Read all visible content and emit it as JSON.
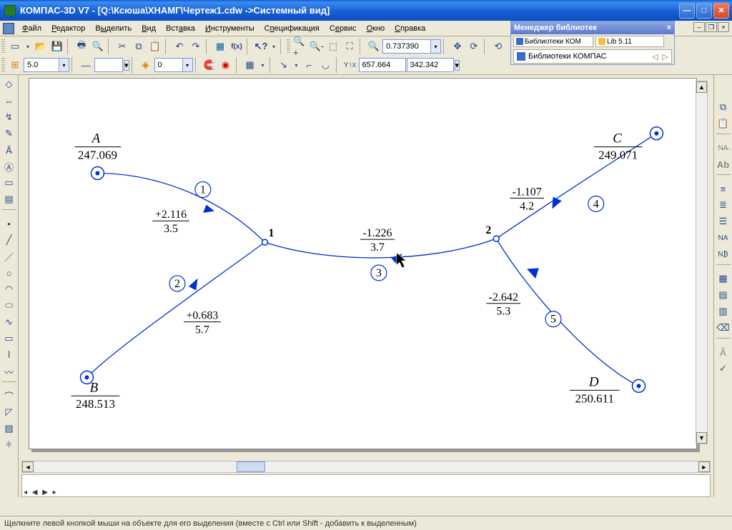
{
  "title": "КОМПАС-3D V7 - [Q:\\Ксюша\\ХНАМГ\\Чертеж1.cdw ->Системный вид]",
  "menu": {
    "file": "Файл",
    "edit": "Редактор",
    "select": "Выделить",
    "view": "Вид",
    "insert": "Вставка",
    "tools": "Инструменты",
    "spec": "Спецификация",
    "service": "Сервис",
    "window": "Окно",
    "help": "Справка"
  },
  "libmgr": {
    "title": "Менеджер библиотек",
    "tab1": "Библиотеки КОМ",
    "tab2": "Lib 5.11",
    "active": "Библиотеки КОМПАС",
    "nav_left": "◁",
    "nav_right": "▷"
  },
  "toolbar1": {
    "zoom": "0.737390",
    "coord_x": "657.664",
    "coord_y": "342.342"
  },
  "toolbar2": {
    "step": "5.0",
    "layer": "0"
  },
  "statusbar": "Щелкните левой кнопкой мыши на объекте для его выделения (вместе с Ctrl или Shift - добавить к выделенным)",
  "drawing": {
    "A": {
      "letter": "A",
      "value": "247.069"
    },
    "B": {
      "letter": "B",
      "value": "248.513"
    },
    "C": {
      "letter": "C",
      "value": "249.071"
    },
    "D": {
      "letter": "D",
      "value": "250.611"
    },
    "n1": "1",
    "n2": "2",
    "c1": "1",
    "c2": "2",
    "c3": "3",
    "c4": "4",
    "c5": "5",
    "e1_top": "+2.116",
    "e1_bot": "3.5",
    "e2_top": "+0.683",
    "e2_bot": "5.7",
    "e3_top": "-1.226",
    "e3_bot": "3.7",
    "e4_top": "-1.107",
    "e4_bot": "4.2",
    "e5_top": "-2.642",
    "e5_bot": "5.3"
  }
}
